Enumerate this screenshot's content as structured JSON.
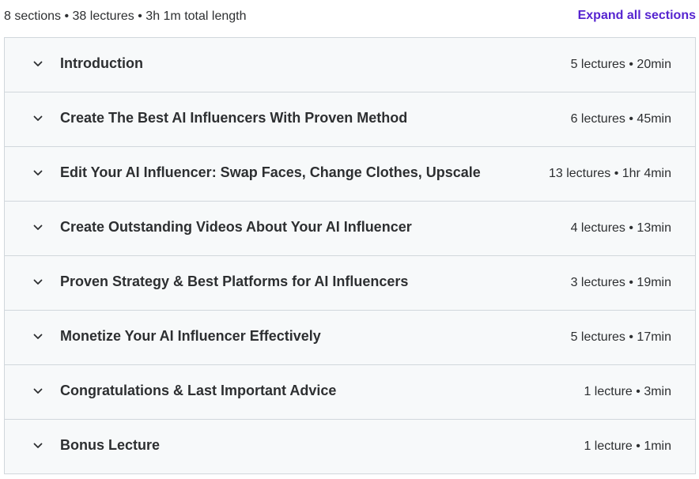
{
  "summary": {
    "text": "8 sections • 38 lectures • 3h 1m total length",
    "expand_label": "Expand all sections"
  },
  "sections": [
    {
      "title": "Introduction",
      "meta": "5 lectures • 20min"
    },
    {
      "title": "Create The Best AI Influencers With Proven Method",
      "meta": "6 lectures • 45min"
    },
    {
      "title": "Edit Your AI Influencer: Swap Faces, Change Clothes, Upscale",
      "meta": "13 lectures • 1hr 4min"
    },
    {
      "title": "Create Outstanding Videos About Your AI Influencer",
      "meta": "4 lectures • 13min"
    },
    {
      "title": "Proven Strategy & Best Platforms for AI Influencers",
      "meta": "3 lectures • 19min"
    },
    {
      "title": "Monetize Your AI Influencer Effectively",
      "meta": "5 lectures • 17min"
    },
    {
      "title": "Congratulations & Last Important Advice",
      "meta": "1 lecture • 3min"
    },
    {
      "title": "Bonus Lecture",
      "meta": "1 lecture • 1min"
    }
  ],
  "icons": {
    "section_toggle": "chevron-down-icon"
  },
  "colors": {
    "accent": "#5624d0",
    "text": "#2d2f31",
    "section_bg": "#f7f9fa",
    "border": "#d1d7dc"
  }
}
